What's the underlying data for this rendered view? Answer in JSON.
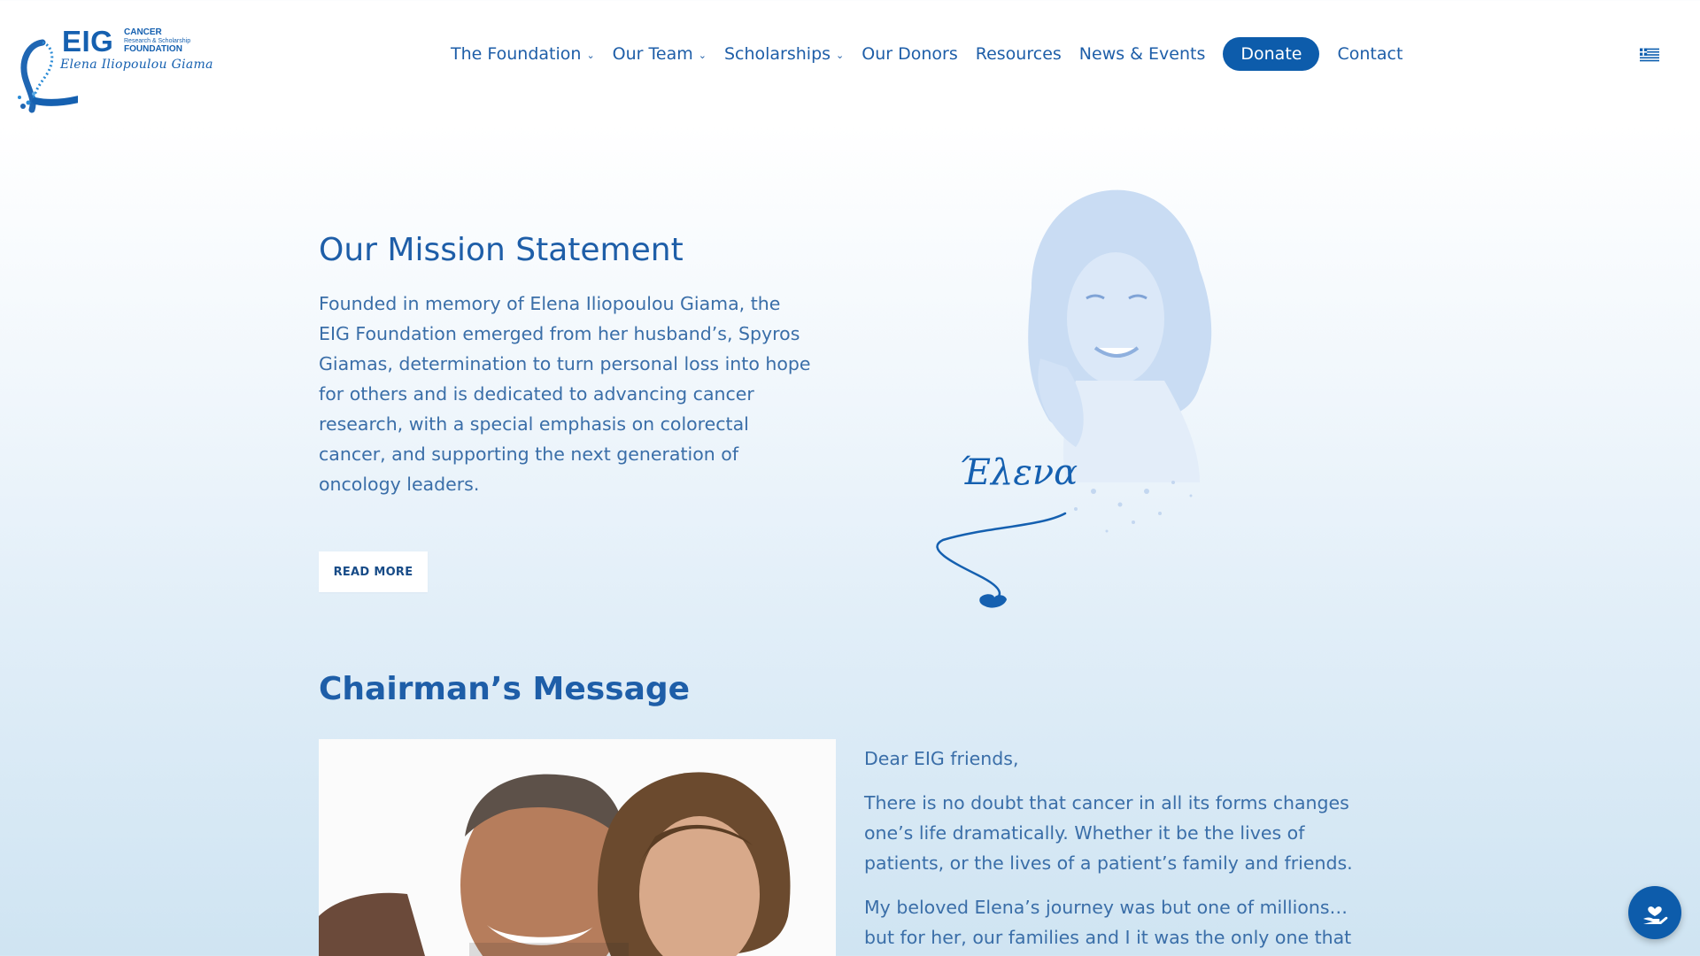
{
  "logo": {
    "eig": "EIG",
    "cancer": "CANCER",
    "research": "Research & Scholarship",
    "foundation": "FOUNDATION",
    "script_name": "Elena Iliopoulou Giama"
  },
  "nav": {
    "items": [
      {
        "label": "The Foundation",
        "dropdown": true
      },
      {
        "label": "Our Team",
        "dropdown": true
      },
      {
        "label": "Scholarships",
        "dropdown": true
      },
      {
        "label": "Our Donors",
        "dropdown": false
      },
      {
        "label": "Resources",
        "dropdown": false
      },
      {
        "label": "News & Events",
        "dropdown": false
      },
      {
        "label": "Donate",
        "dropdown": false
      },
      {
        "label": "Contact",
        "dropdown": false
      }
    ],
    "language_icon": "greek-flag-icon"
  },
  "mission": {
    "title": "Our Mission Statement",
    "text": "Founded in memory of Elena Iliopoulou Giama, the EIG Foundation emerged from her husband’s, Spyros Giamas, determination to turn personal loss into hope for others and is dedicated to advancing cancer research, with a special emphasis on colorectal cancer, and supporting the next generation of oncology leaders.",
    "button": "READ MORE",
    "signature": "Έλενα"
  },
  "chairman": {
    "title": "Chairman’s Message",
    "paragraphs": [
      "Dear EIG friends,",
      "There is no doubt that cancer in all its forms changes one’s life dramatically. Whether it be the lives of patients, or the lives of a patient’s family and friends.",
      "My beloved Elena’s journey was but one of millions… but for her, our families and I it was the only one that"
    ]
  },
  "colors": {
    "brand": "#0d5cab",
    "text": "#1e5ea8",
    "body_text": "#3a6ea8"
  },
  "icons": {
    "float_button": "helping-hand-heart-icon"
  }
}
